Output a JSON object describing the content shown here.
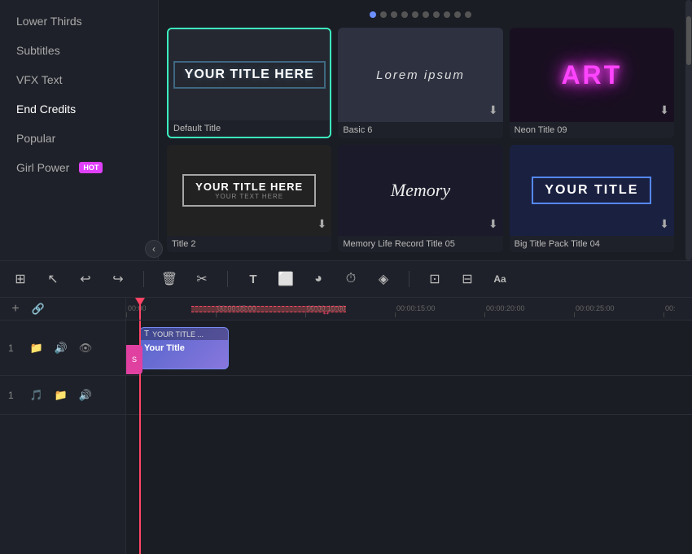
{
  "sidebar": {
    "items": [
      {
        "id": "lower-thirds",
        "label": "Lower Thirds",
        "active": false,
        "hot": false
      },
      {
        "id": "subtitles",
        "label": "Subtitles",
        "active": false,
        "hot": false
      },
      {
        "id": "vfx-text",
        "label": "VFX Text",
        "active": false,
        "hot": false
      },
      {
        "id": "end-credits",
        "label": "End Credits",
        "active": true,
        "hot": false
      },
      {
        "id": "popular",
        "label": "Popular",
        "active": false,
        "hot": false
      },
      {
        "id": "girl-power",
        "label": "Girl Power",
        "active": false,
        "hot": true
      }
    ]
  },
  "dots": {
    "count": 10,
    "active_index": 0
  },
  "cards": [
    {
      "id": "default-title",
      "label": "Default Title",
      "type": "default",
      "selected": true,
      "preview_text": "YOUR TITLE HERE"
    },
    {
      "id": "basic-6",
      "label": "Basic 6",
      "type": "basic",
      "selected": false,
      "preview_text": "Lorem ipsum"
    },
    {
      "id": "neon-title-09",
      "label": "Neon Title 09",
      "type": "neon",
      "selected": false,
      "preview_text": "ART"
    },
    {
      "id": "title-2",
      "label": "Title 2",
      "type": "title2",
      "selected": false,
      "preview_text": "YOUR TITLE HERE",
      "sub_text": "YOUR TEXT HERE"
    },
    {
      "id": "memory-life",
      "label": "Memory Life Record Title 05",
      "type": "memory",
      "selected": false,
      "preview_text": "Memory"
    },
    {
      "id": "big-title-pack",
      "label": "Big Title Pack Title 04",
      "type": "bigtitle",
      "selected": false,
      "preview_text": "YOUR TITLE"
    }
  ],
  "toolbar": {
    "buttons": [
      {
        "id": "group",
        "icon": "⊞",
        "label": "group"
      },
      {
        "id": "select",
        "icon": "↖",
        "label": "select"
      },
      {
        "id": "undo",
        "icon": "↩",
        "label": "undo"
      },
      {
        "id": "redo",
        "icon": "↪",
        "label": "redo"
      },
      {
        "id": "delete",
        "icon": "🗑",
        "label": "delete"
      },
      {
        "id": "cut",
        "icon": "✂",
        "label": "cut"
      },
      {
        "id": "text",
        "icon": "T",
        "label": "text"
      },
      {
        "id": "crop",
        "icon": "⬜",
        "label": "crop"
      },
      {
        "id": "color",
        "icon": "◕",
        "label": "color"
      },
      {
        "id": "speed",
        "icon": "⏱",
        "label": "speed"
      },
      {
        "id": "effects",
        "icon": "◈",
        "label": "effects"
      },
      {
        "id": "more1",
        "icon": "⊡",
        "label": "more1"
      },
      {
        "id": "more2",
        "icon": "⊞",
        "label": "more2"
      },
      {
        "id": "more3",
        "icon": "Aa",
        "label": "more3"
      }
    ]
  },
  "timeline": {
    "tracks": [
      {
        "id": "video-1",
        "number": "1",
        "type": "video",
        "icons": [
          "📁",
          "🔊",
          "👁"
        ]
      },
      {
        "id": "audio-1",
        "number": "1",
        "type": "audio",
        "icons": [
          "🎵",
          "📁",
          "🔊"
        ]
      }
    ],
    "ruler": {
      "marks": [
        "00:00",
        "00:00:05:00",
        "00:00:10:00",
        "00:00:15:00",
        "00:00:20:00",
        "00:00:25:00",
        "00:"
      ]
    },
    "title_clip": {
      "label": "YOUR TITLE ...",
      "icon": "T"
    },
    "time_marker_label": "S"
  }
}
